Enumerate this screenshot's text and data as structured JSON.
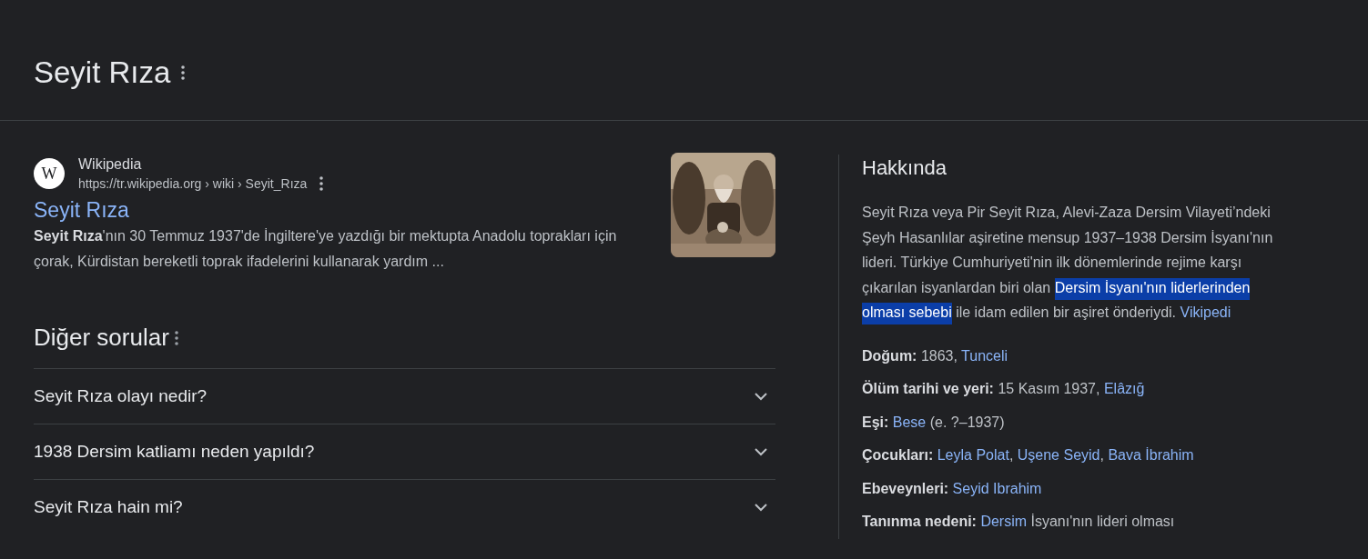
{
  "header": {
    "title": "Seyit Rıza"
  },
  "result": {
    "site_name": "Wikipedia",
    "favicon": "W",
    "url": "https://tr.wikipedia.org › wiki › Seyit_Rıza",
    "title": "Seyit Rıza",
    "snippet": "**Seyit Rıza**'nın 30 Temmuz 1937'de İngiltere'ye yazdığı bir mektupta Anadolu toprakları için çorak, Kürdistan bereketli toprak ifadelerini kullanarak yardım ..."
  },
  "questions": {
    "title": "Diğer sorular",
    "items": [
      {
        "text": "Seyit Rıza olayı nedir?",
        "expanded": false
      },
      {
        "text": "1938 Dersim katliamı neden yapıldı?",
        "expanded": false
      },
      {
        "text": "Seyit Rıza hain mi?",
        "expanded": false
      }
    ]
  },
  "about": {
    "title": "Hakkında",
    "description": [
      {
        "kind": "text",
        "text": "Seyit Rıza veya Pir Seyit Rıza, Alevi-Zaza Dersim Vilayeti’ndeki Şeyh Hasanlılar aşiretine mensup 1937–1938 Dersim İsyanı'nın lideri. Türkiye Cumhuriyeti'nin ilk dönemlerinde rejime karşı çıkarılan isyanlardan biri olan "
      },
      {
        "kind": "text",
        "text": "Dersim İsyanı'nın liderlerinden olması sebebi",
        "selected": true
      },
      {
        "kind": "text",
        "text": " ile idam edilen bir aşiret önderiydi. "
      },
      {
        "kind": "link",
        "text": "Vikipedi"
      }
    ],
    "facts": [
      {
        "label": "Doğum:",
        "value": [
          {
            "kind": "text",
            "text": "1863, "
          },
          {
            "kind": "link",
            "text": "Tunceli"
          }
        ]
      },
      {
        "label": "Ölüm tarihi ve yeri:",
        "value": [
          {
            "kind": "text",
            "text": "15 Kasım 1937, "
          },
          {
            "kind": "link",
            "text": "Elâzığ"
          }
        ]
      },
      {
        "label": "Eşi:",
        "value": [
          {
            "kind": "link",
            "text": "Bese"
          },
          {
            "kind": "text",
            "text": " (e. ?–1937)"
          }
        ]
      },
      {
        "label": "Çocukları:",
        "value": [
          {
            "kind": "link",
            "text": "Leyla Polat"
          },
          {
            "kind": "text",
            "text": ", "
          },
          {
            "kind": "link",
            "text": "Uşene Seyid"
          },
          {
            "kind": "text",
            "text": ", "
          },
          {
            "kind": "link",
            "text": "Bava İbrahim"
          }
        ]
      },
      {
        "label": "Ebeveynleri:",
        "value": [
          {
            "kind": "link",
            "text": "Seyid Ibrahim"
          }
        ]
      },
      {
        "label": "Tanınma nedeni:",
        "value": [
          {
            "kind": "link",
            "text": "Dersim"
          },
          {
            "kind": "text",
            "text": " İsyanı'nın lideri olması"
          }
        ]
      }
    ]
  }
}
